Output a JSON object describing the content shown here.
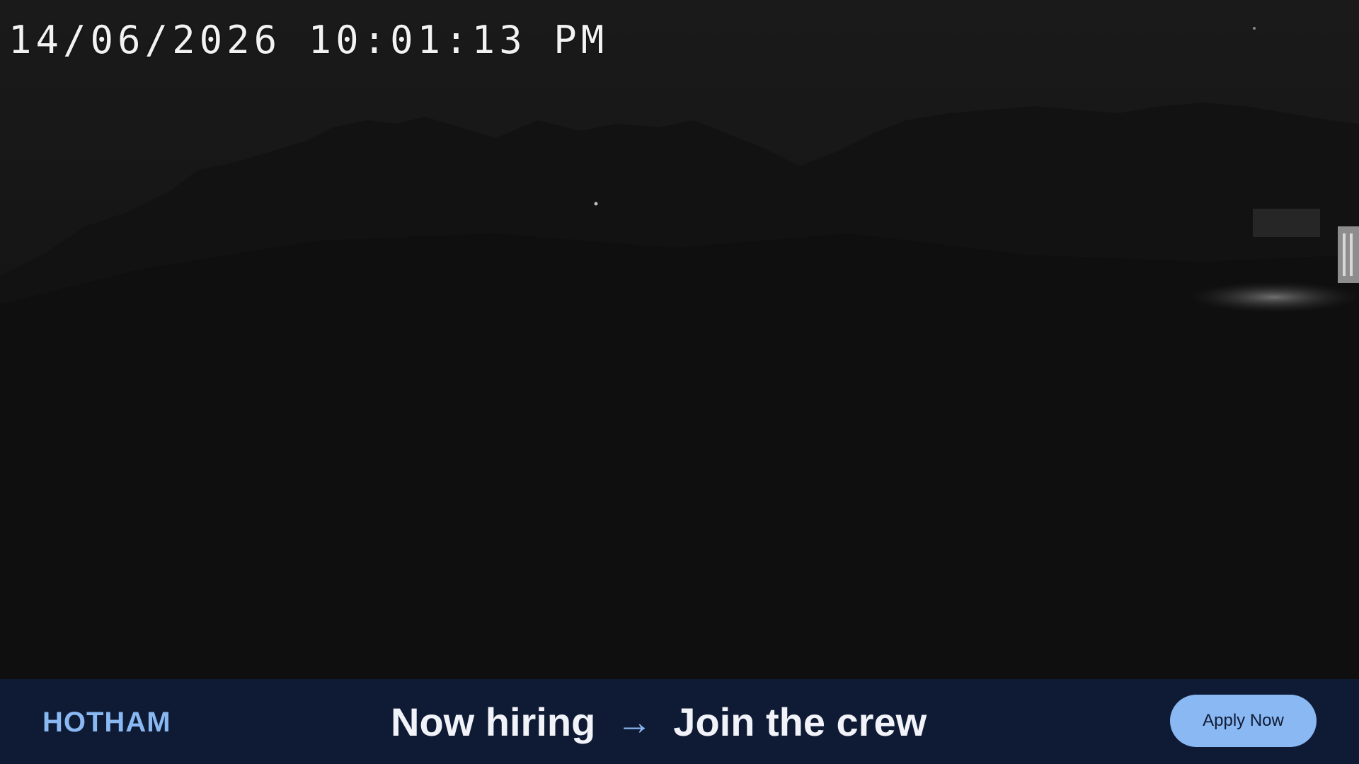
{
  "camera": {
    "timestamp": "14/06/2026 10:01:13 PM"
  },
  "banner": {
    "brand": "HOTHAM",
    "headline_left": "Now hiring",
    "arrow": "→",
    "headline_right": "Join the crew",
    "button_label": "Apply Now",
    "colors": {
      "background": "#0f1b35",
      "accent": "#8ab8f3",
      "text": "#f1f3f8"
    }
  }
}
